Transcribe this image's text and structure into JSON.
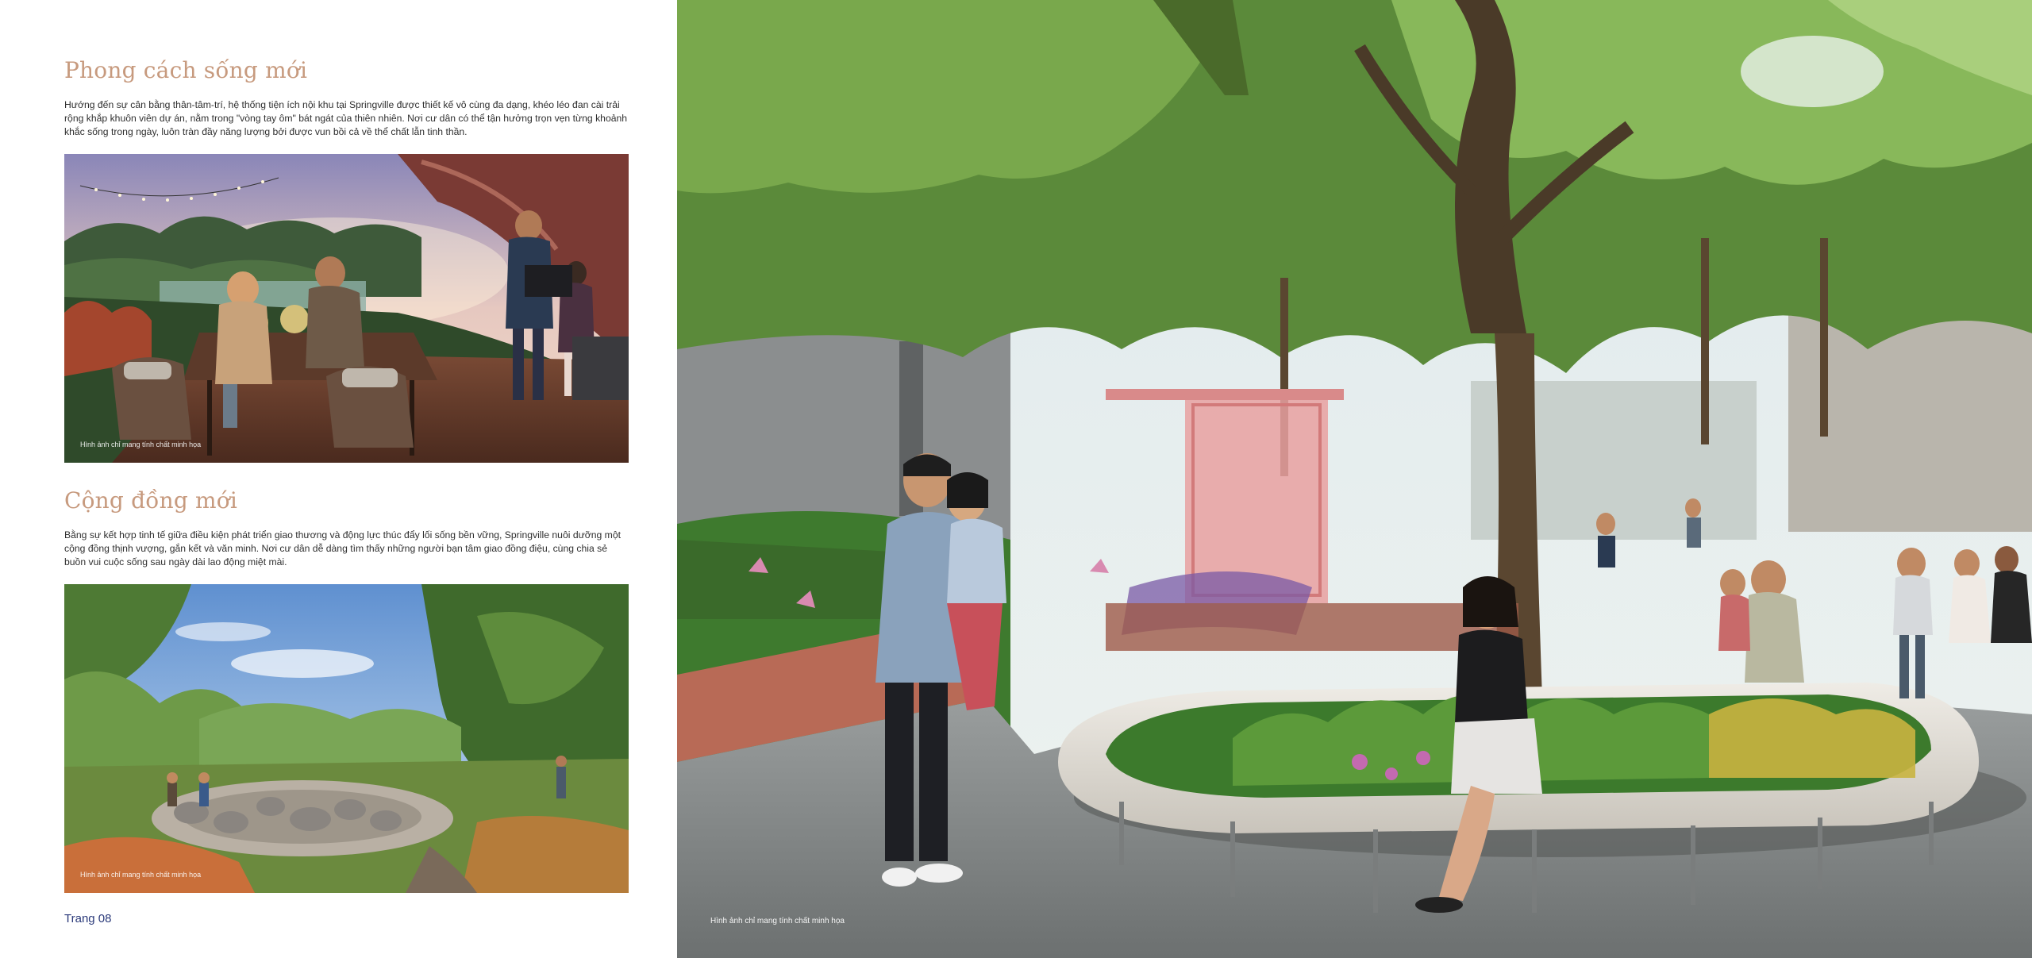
{
  "sections": [
    {
      "title": "Phong cách sống mới",
      "body": "Hướng đến sự cân bằng thân-tâm-trí, hệ thống tiện ích nội khu tại Springville được thiết kế vô cùng đa dạng, khéo léo đan cài trải rộng khắp khuôn viên dự án, nằm trong \"vòng tay ôm\" bát ngát của thiên nhiên. Nơi cư dân có thể tận hưởng trọn vẹn từng khoảnh khắc sống trong ngày, luôn tràn đầy năng lượng bởi được vun bồi cả về thể chất lẫn tinh thần.",
      "image_caption": "Hình ảnh chỉ mang tính chất minh họa"
    },
    {
      "title": "Cộng đồng mới",
      "body": "Bằng sự kết hợp tinh tế giữa điều kiện phát triển giao thương và động lực thúc đẩy lối sống bền vững, Springville nuôi dưỡng một cộng đồng thịnh vượng, gắn kết và văn minh. Nơi cư dân dễ dàng tìm thấy những người bạn tâm giao đồng điệu, cùng chia sẻ buồn vui cuộc sống sau ngày dài lao động miệt mài.",
      "image_caption": "Hình ảnh chỉ mang tính chất minh họa"
    }
  ],
  "page_number": "Trang 08",
  "right_image_caption": "Hình ảnh chỉ mang tính chất minh họa",
  "colors": {
    "title": "#c79a7e",
    "page_number": "#2b3a7a",
    "body_text": "#2f2f2f"
  }
}
